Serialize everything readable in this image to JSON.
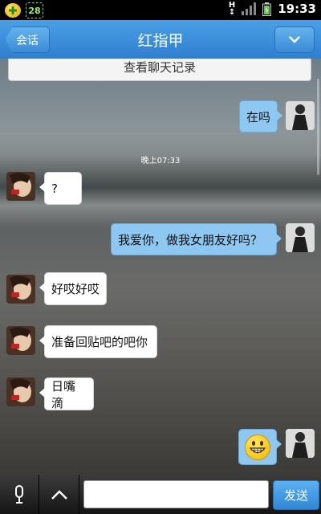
{
  "status_bar": {
    "badge_number": "28",
    "signal_label": "H",
    "time": "19:33"
  },
  "header": {
    "back_label": "会话",
    "title": "红指甲"
  },
  "chat": {
    "history_button": "查看聊天记录",
    "timestamp": "晚上07:33",
    "messages": [
      {
        "side": "out",
        "text": "在吗"
      },
      {
        "side": "in",
        "text": "?"
      },
      {
        "side": "out",
        "text": "我爱你，做我女朋友好吗？"
      },
      {
        "side": "in",
        "text": "好哎好哎"
      },
      {
        "side": "in",
        "text": "准备回贴吧的吧你"
      },
      {
        "side": "in",
        "text": "日嘴滴"
      },
      {
        "side": "out",
        "text": "",
        "emoji": "grinning-face"
      }
    ]
  },
  "input": {
    "value": "",
    "send_label": "发送"
  },
  "colors": {
    "header_blue": "#3a8ad6",
    "outgoing_bubble": "#8ec8f2",
    "incoming_bubble": "#ffffff"
  }
}
